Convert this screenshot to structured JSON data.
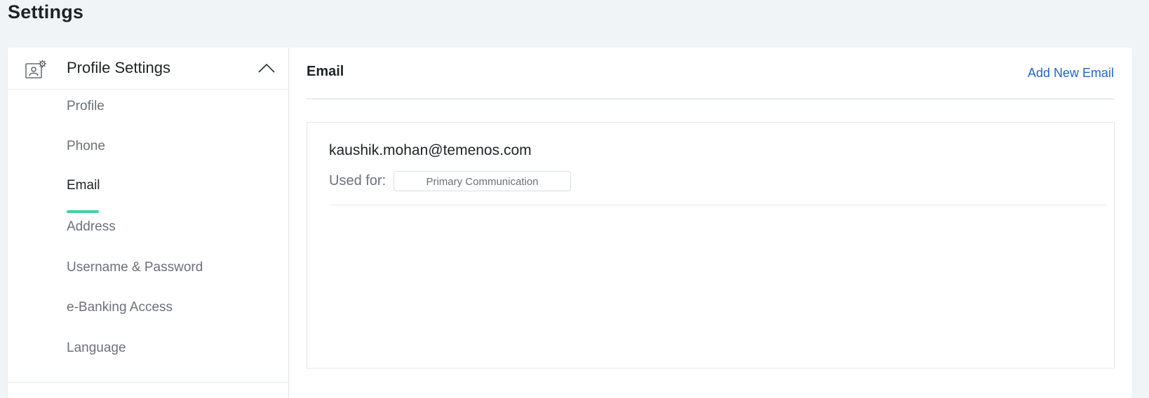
{
  "page": {
    "title": "Settings"
  },
  "sidebar": {
    "header_label": "Profile Settings",
    "header_icon": "profile-settings-icon",
    "collapse_icon": "chevron-up-icon",
    "items": [
      {
        "label": "Profile"
      },
      {
        "label": "Phone"
      },
      {
        "label": "Email"
      },
      {
        "label": "Address"
      },
      {
        "label": "Username & Password"
      },
      {
        "label": "e-Banking Access"
      },
      {
        "label": "Language"
      }
    ],
    "active_item": "Email",
    "accent_color": "#3fd3a6"
  },
  "main": {
    "title": "Email",
    "add_link_label": "Add New Email",
    "link_color": "#1f66c9",
    "emails": [
      {
        "address": "kaushik.mohan@temenos.com",
        "used_for_label": "Used for:",
        "usage": "Primary Communication"
      }
    ]
  }
}
